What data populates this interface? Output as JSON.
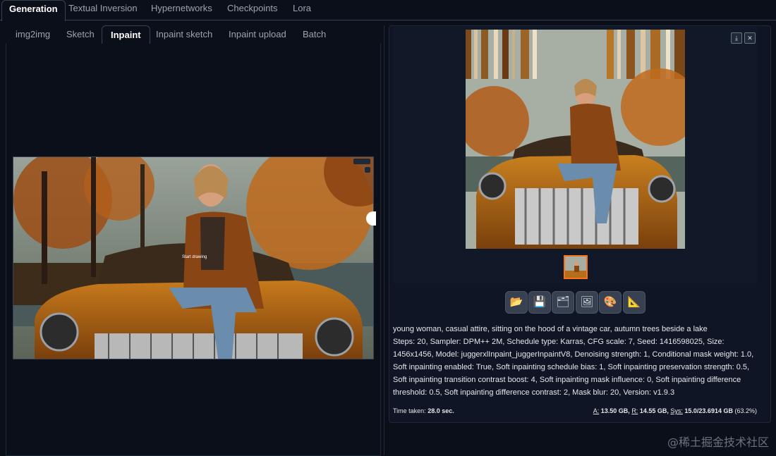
{
  "top_tabs": [
    "Generation",
    "Textual Inversion",
    "Hypernetworks",
    "Checkpoints",
    "Lora"
  ],
  "sub_tabs": [
    "img2img",
    "Sketch",
    "Inpaint",
    "Inpaint sketch",
    "Inpaint upload",
    "Batch"
  ],
  "canvas_overlay_text": "Start drawing",
  "gallery_icons": {
    "download": "download-icon",
    "close": "close-icon"
  },
  "toolbar": [
    {
      "icon": "folder-icon",
      "glyph": "📂"
    },
    {
      "icon": "save-icon",
      "glyph": "💾"
    },
    {
      "icon": "zip-icon",
      "glyph": "🗂"
    },
    {
      "icon": "image-icon",
      "glyph": "🖼"
    },
    {
      "icon": "palette-icon",
      "glyph": "🎨"
    },
    {
      "icon": "ruler-icon",
      "glyph": "📐"
    }
  ],
  "info": {
    "prompt": "young woman, casual attire, sitting on the hood of a vintage car, autumn trees beside a lake",
    "params": "Steps: 20, Sampler: DPM++ 2M, Schedule type: Karras, CFG scale: 7, Seed: 1416598025, Size: 1456x1456, Model: juggerxlInpaint_juggerInpaintV8, Denoising strength: 1, Conditional mask weight: 1.0, Soft inpainting enabled: True, Soft inpainting schedule bias: 1, Soft inpainting preservation strength: 0.5, Soft inpainting transition contrast boost: 4, Soft inpainting mask influence: 0, Soft inpainting difference threshold: 0.5, Soft inpainting difference contrast: 2, Mask blur: 20, Version: v1.9.3"
  },
  "time_label": "Time taken:",
  "time_value": "28.0 sec.",
  "mem": {
    "a_label": "A:",
    "a_value": "13.50 GB,",
    "r_label": "R:",
    "r_value": "14.55 GB,",
    "sys_label": "Sys:",
    "sys_value": "15.0/23.6914 GB",
    "sys_pct": "(63.2%)"
  },
  "watermark": "@稀土掘金技术社区",
  "colors": {
    "bg": "#0b0f19",
    "accent": "#f97316",
    "panel": "#111827"
  }
}
